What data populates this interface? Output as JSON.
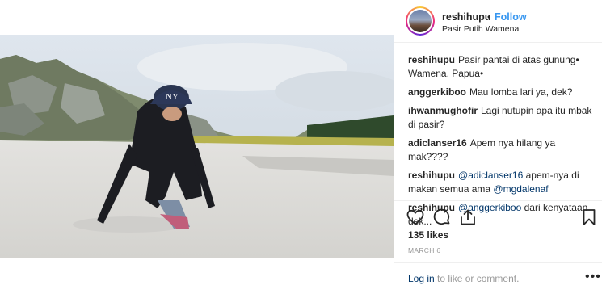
{
  "post": {
    "username": "reshihupu",
    "dot": "•",
    "follow_label": "Follow",
    "location": "Pasir Putih Wamena",
    "cap_logo": "NY"
  },
  "comments": [
    {
      "user": "reshihupu",
      "text": "Pasir pantai di atas gunung• Wamena, Papua•",
      "mention": ""
    },
    {
      "user": "anggerkiboo",
      "text": "Mau lomba lari ya, dek?",
      "mention": ""
    },
    {
      "user": "ihwanmughofir",
      "text": "Lagi nutupin apa itu mbak di pasir?",
      "mention": ""
    },
    {
      "user": "adiclanser16",
      "text": "Apem nya hilang ya mak????",
      "mention": ""
    },
    {
      "user": "reshihupu",
      "mention": "@adiclanser16",
      "text": "apem-nya di makan semua ama",
      "mention2": "@mgdalenaf"
    },
    {
      "user": "reshihupu",
      "mention": "@anggerkiboo",
      "text": "dari kenyataan dek..."
    }
  ],
  "actions": {
    "like_icon": "heart-icon",
    "comment_icon": "comment-icon",
    "share_icon": "share-icon",
    "save_icon": "bookmark-icon"
  },
  "likes": "135 likes",
  "date": "MARCH 6",
  "login": {
    "link": "Log in",
    "rest": "to like or comment.",
    "more": "•••"
  }
}
